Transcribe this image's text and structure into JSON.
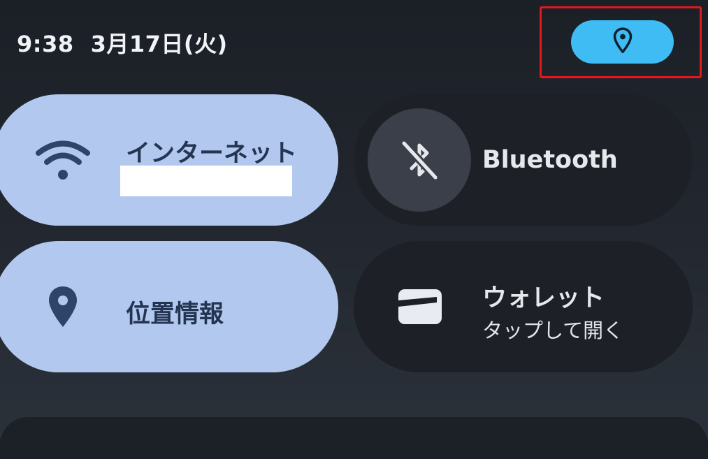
{
  "status_bar": {
    "time": "9:38",
    "date": "3月17日(火)"
  },
  "privacy_chip": {
    "icon": "location-pin-icon",
    "color": "#3ebcf3",
    "highlight_color": "#e0191c"
  },
  "tiles": {
    "internet": {
      "label": "インターネット",
      "icon": "wifi-icon",
      "state": "on"
    },
    "bluetooth": {
      "label": "Bluetooth",
      "icon": "bluetooth-off-icon",
      "state": "off"
    },
    "location": {
      "label": "位置情報",
      "icon": "location-pin-icon",
      "state": "on"
    },
    "wallet": {
      "label": "ウォレット",
      "sublabel": "タップして開く",
      "icon": "wallet-card-icon",
      "state": "off"
    }
  },
  "colors": {
    "tile_on": "#b3c8ee",
    "tile_on_text": "#243552",
    "tile_off": "#1d2027",
    "background": "#1b1f26"
  }
}
